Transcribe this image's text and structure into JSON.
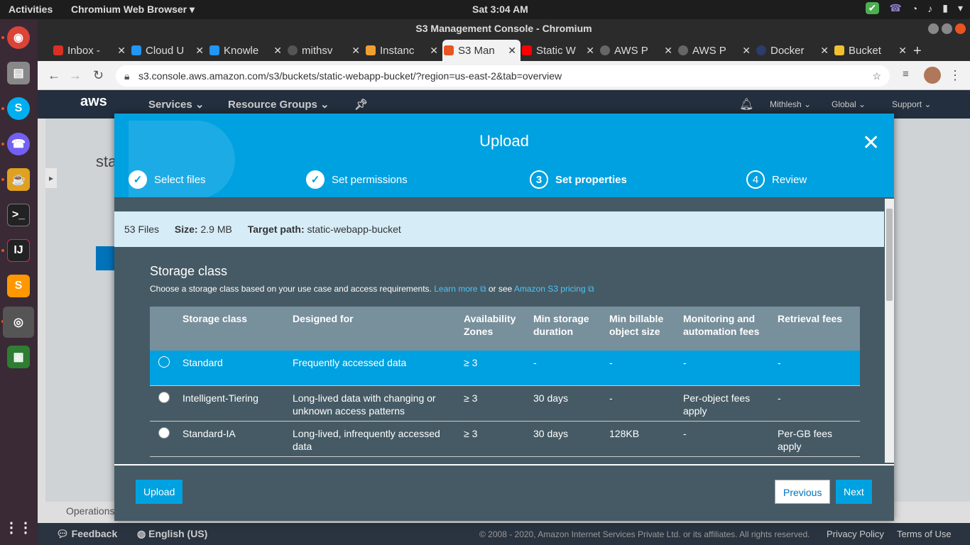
{
  "os": {
    "activities": "Activities",
    "app_name": "Chromium Web Browser",
    "clock": "Sat  3:04 AM"
  },
  "window": {
    "title": "S3 Management Console - Chromium"
  },
  "tabs": [
    {
      "label": "Inbox -",
      "color": "#d93025"
    },
    {
      "label": "Cloud U",
      "color": "#2196f3"
    },
    {
      "label": "Knowle",
      "color": "#2196f3"
    },
    {
      "label": "mithsv",
      "color": "#333333"
    },
    {
      "label": "Instanc",
      "color": "#f0a030"
    },
    {
      "label": "S3 Man",
      "color": "#e95420"
    },
    {
      "label": "Static W",
      "color": "#ff0000"
    },
    {
      "label": "AWS P",
      "color": "#666666"
    },
    {
      "label": "AWS P",
      "color": "#666666"
    },
    {
      "label": "Docker",
      "color": "#2a3d6b"
    },
    {
      "label": "Bucket",
      "color": "#f0c030"
    }
  ],
  "address": {
    "url": "s3.console.aws.amazon.com/s3/buckets/static-webapp-bucket/?region=us-east-2&tab=overview"
  },
  "aws_nav": {
    "logo": "aws",
    "services": "Services",
    "resource_groups": "Resource Groups",
    "user": "Mithlesh",
    "region": "Global",
    "support": "Support"
  },
  "background": {
    "bucket_title": "sta",
    "operations": "Operations"
  },
  "modal": {
    "title": "Upload",
    "steps": [
      {
        "num": "✓",
        "label": "Select files"
      },
      {
        "num": "✓",
        "label": "Set permissions"
      },
      {
        "num": "3",
        "label": "Set properties"
      },
      {
        "num": "4",
        "label": "Review"
      }
    ],
    "summary": {
      "files": "53 Files",
      "size_label": "Size:",
      "size_value": "2.9 MB",
      "target_label": "Target path:",
      "target_value": "static-webapp-bucket"
    },
    "storage": {
      "title": "Storage class",
      "desc": "Choose a storage class based on your use case and access requirements.",
      "learn_more": "Learn more",
      "or_see": "or see",
      "pricing": "Amazon S3 pricing"
    },
    "table": {
      "headers": [
        "Storage class",
        "Designed for",
        "Availability Zones",
        "Min storage duration",
        "Min billable object size",
        "Monitoring and automation fees",
        "Retrieval fees"
      ],
      "rows": [
        [
          "Standard",
          "Frequently accessed data",
          "≥ 3",
          "-",
          "-",
          "-",
          "-"
        ],
        [
          "Intelligent-Tiering",
          "Long-lived data with changing or unknown access patterns",
          "≥ 3",
          "30 days",
          "-",
          "Per-object fees apply",
          "-"
        ],
        [
          "Standard-IA",
          "Long-lived, infrequently accessed data",
          "≥ 3",
          "30 days",
          "128KB",
          "-",
          "Per-GB fees apply"
        ]
      ]
    },
    "buttons": {
      "upload": "Upload",
      "previous": "Previous",
      "next": "Next"
    }
  },
  "footer": {
    "feedback": "Feedback",
    "language": "English (US)",
    "copyright": "© 2008 - 2020, Amazon Internet Services Private Ltd. or its affiliates. All rights reserved.",
    "privacy": "Privacy Policy",
    "terms": "Terms of Use"
  }
}
